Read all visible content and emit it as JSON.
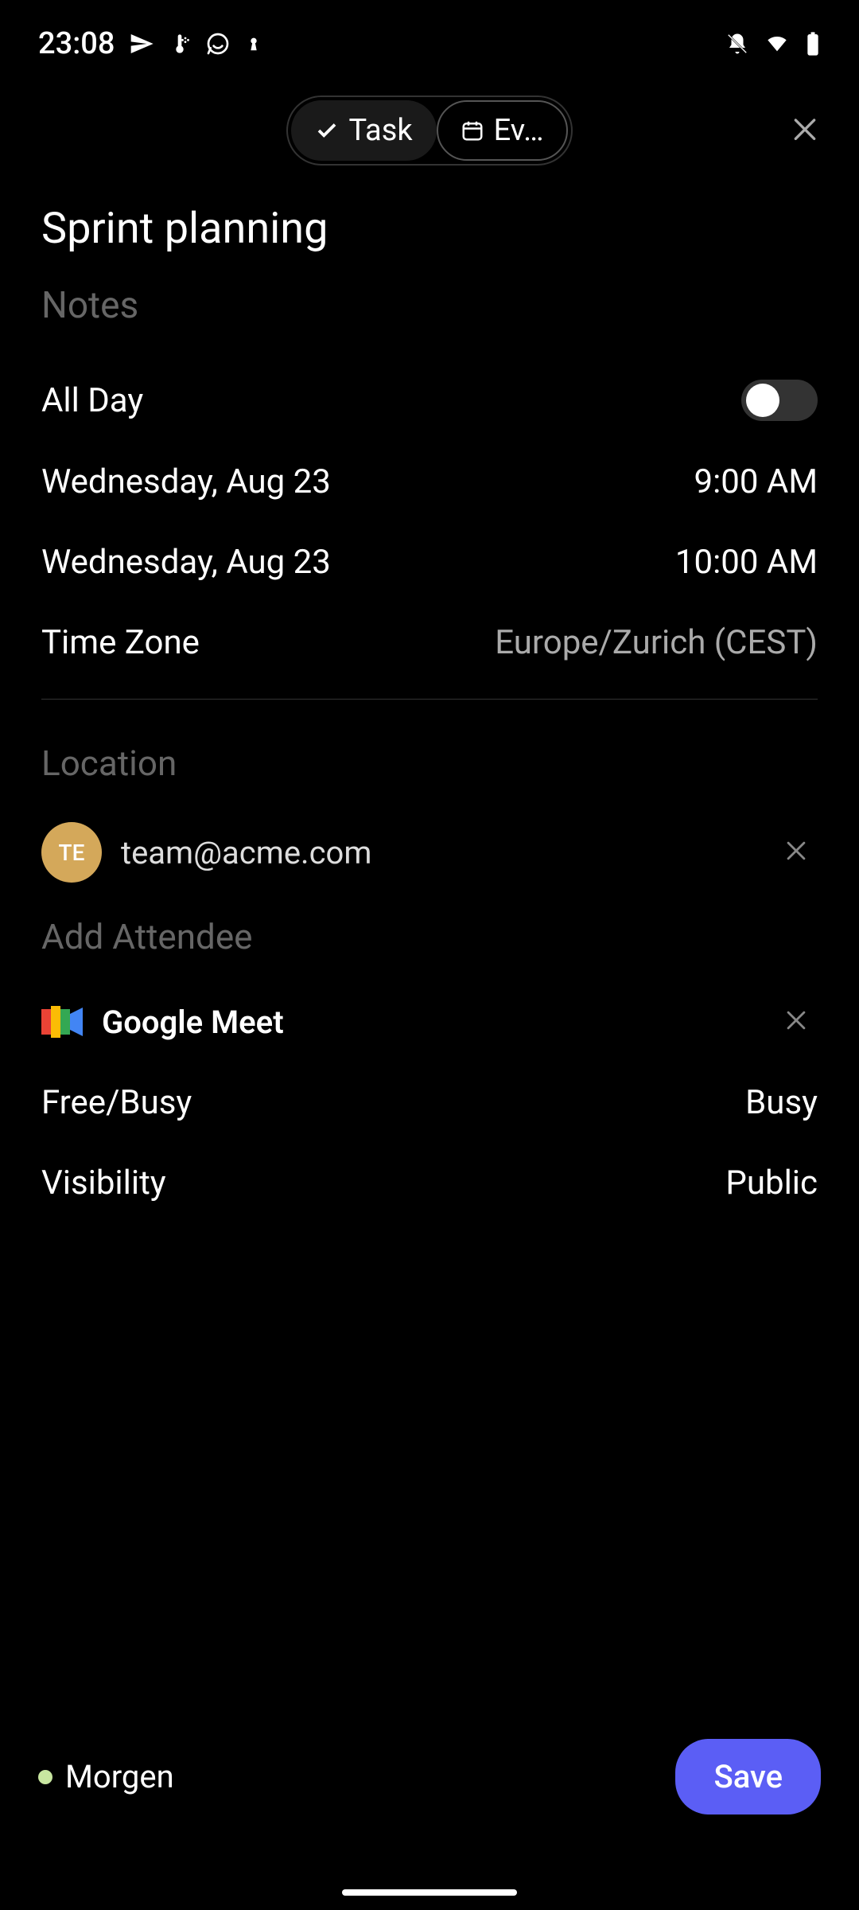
{
  "status_bar": {
    "time": "23:08"
  },
  "header": {
    "task_label": "Task",
    "event_label": "Ev…",
    "active_segment": "event"
  },
  "event": {
    "title": "Sprint planning",
    "notes_placeholder": "Notes",
    "all_day_label": "All Day",
    "all_day": false,
    "start_date": "Wednesday, Aug 23",
    "start_time": "9:00 AM",
    "end_date": "Wednesday, Aug 23",
    "end_time": "10:00 AM",
    "timezone_label": "Time Zone",
    "timezone_value": "Europe/Zurich (CEST)",
    "location_placeholder": "Location",
    "attendees": [
      {
        "initials": "TE",
        "email": "team@acme.com"
      }
    ],
    "add_attendee_placeholder": "Add Attendee",
    "conference_label": "Google Meet",
    "freebusy_label": "Free/Busy",
    "freebusy_value": "Busy",
    "visibility_label": "Visibility",
    "visibility_value": "Public"
  },
  "footer": {
    "calendar_name": "Morgen",
    "calendar_color": "#c8e6a0",
    "save_label": "Save"
  }
}
